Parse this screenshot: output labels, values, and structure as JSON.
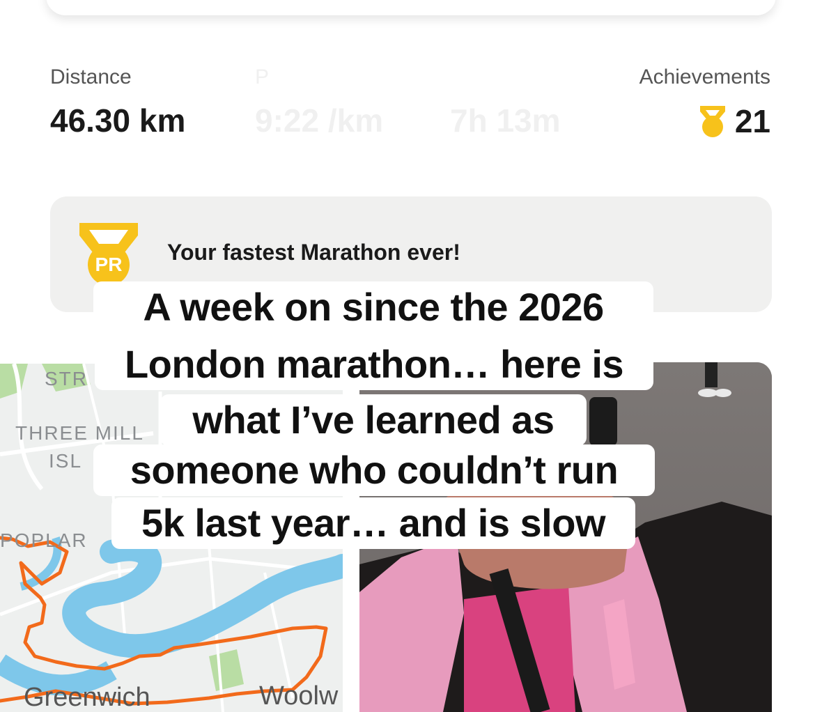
{
  "stats": {
    "distance_label": "Distance",
    "distance_value": "46.30 km",
    "pace_label": "P",
    "pace_value": "9:22 /km",
    "time_value": "7h 13m",
    "achievements_label": "Achievements",
    "achievements_value": "21"
  },
  "pr_card": {
    "badge_text": "PR",
    "message": "Your fastest Marathon ever!"
  },
  "overlay": {
    "lines": [
      "A week on since the 2026",
      "London marathon… here is",
      "what I’ve learned as",
      "someone who couldn’t run",
      "5k last year… and is slow"
    ]
  },
  "map": {
    "labels": {
      "stratford": "STR",
      "three_mills": "THREE MILL",
      "island": "ISL",
      "poplar": "POPLAR",
      "greenwich": "Greenwich",
      "woolwich": "Woolw"
    }
  },
  "colors": {
    "badge_gold": "#F7C21B",
    "badge_gold_dark": "#E3A816",
    "route_orange": "#F26A1B",
    "river_blue": "#7EC7EA",
    "park_green": "#B9DDA4"
  }
}
